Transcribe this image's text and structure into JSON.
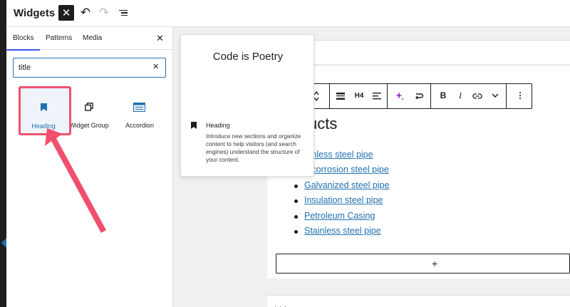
{
  "header": {
    "title": "Widgets",
    "close_symbol": "✕",
    "undo_symbol": "↶",
    "redo_symbol": "↷"
  },
  "sidebar": {
    "tabs": [
      {
        "label": "Blocks",
        "active": true
      },
      {
        "label": "Patterns",
        "active": false
      },
      {
        "label": "Media",
        "active": false
      }
    ],
    "close_symbol": "✕",
    "search": {
      "value": "title",
      "clear_symbol": "✕"
    },
    "blocks": [
      {
        "label": "Heading",
        "icon": "bookmark-icon",
        "selected": true
      },
      {
        "label": "Widget Group",
        "icon": "group-icon",
        "selected": false
      },
      {
        "label": "Accordion",
        "icon": "accordion-icon",
        "selected": false
      }
    ]
  },
  "preview": {
    "title": "Code is Poetry",
    "block_name": "Heading",
    "description": "Introduce new sections and organize content to help visitors (and search engines) understand the structure of your content."
  },
  "toolbar": {
    "heading_level": "H4",
    "bold": "B",
    "italic": "I",
    "more": "⋮"
  },
  "content": {
    "heading_fragment": "ucts",
    "products": [
      "amless steel pipe",
      "ti-corrosion steel pipe",
      "Galvanized steel pipe",
      "Insulation steel pipe",
      "Petroleum Casing",
      "Stainless steel pipe"
    ],
    "appender_symbol": "+"
  },
  "colors": {
    "accent": "#2271b1",
    "highlight": "#f0506e",
    "ai_icon": "#9b2fc8"
  }
}
